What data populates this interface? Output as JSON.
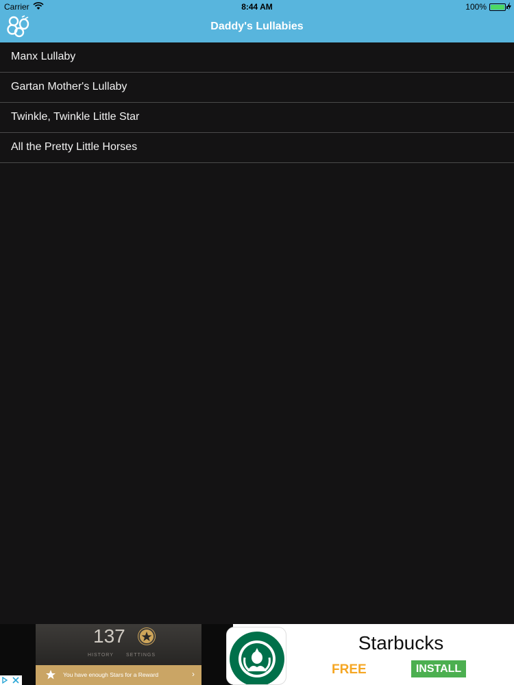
{
  "status_bar": {
    "carrier": "Carrier",
    "time": "8:44 AM",
    "battery_percent": "100%",
    "battery_color": "#4cd964"
  },
  "nav": {
    "title": "Daddy's Lullabies",
    "logo_icon": "bee-logo-icon",
    "background": "#58b5dd"
  },
  "songs": [
    {
      "label": "Manx Lullaby"
    },
    {
      "label": "Gartan Mother's Lullaby"
    },
    {
      "label": "Twinkle, Twinkle Little Star"
    },
    {
      "label": "All the Pretty Little Horses"
    }
  ],
  "ad": {
    "stars_count": "137",
    "tab_history": "HISTORY",
    "tab_settings": "SETTINGS",
    "reward_text": "You have enough Stars for a Reward",
    "brand": "Starbucks",
    "price": "FREE",
    "install_label": "INSTALL"
  }
}
